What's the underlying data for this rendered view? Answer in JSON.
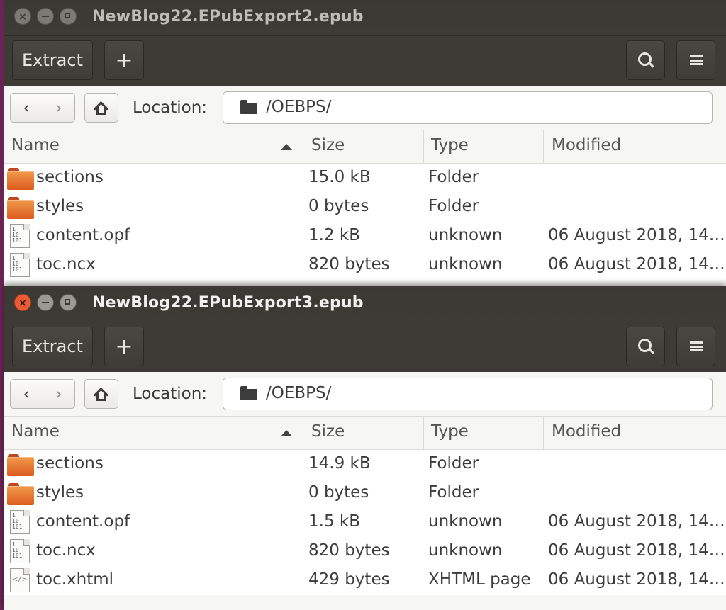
{
  "colors": {
    "close_active": "#ea5b33",
    "folder_orange": "#e0662a",
    "header_dark": "#3e3a36"
  },
  "windows": [
    {
      "title": "NewBlog22.EPubExport2.epub",
      "active": false,
      "toolbar": {
        "extract_label": "Extract",
        "add_label": "+",
        "search_icon": "search-icon",
        "menu_icon": "menu-icon"
      },
      "location": {
        "label": "Location:",
        "path": "/OEBPS/"
      },
      "columns": {
        "name": "Name",
        "size": "Size",
        "type": "Type",
        "modified": "Modified"
      },
      "files": [
        {
          "icon": "folder-icon",
          "name": "sections",
          "size": "15.0 kB",
          "type": "Folder",
          "modified": ""
        },
        {
          "icon": "folder-icon",
          "name": "styles",
          "size": "0 bytes",
          "type": "Folder",
          "modified": ""
        },
        {
          "icon": "binary-file-icon",
          "name": "content.opf",
          "size": "1.2 kB",
          "type": "unknown",
          "modified": "06 August 2018, 14…"
        },
        {
          "icon": "binary-file-icon",
          "name": "toc.ncx",
          "size": "820 bytes",
          "type": "unknown",
          "modified": "06 August 2018, 14…"
        }
      ]
    },
    {
      "title": "NewBlog22.EPubExport3.epub",
      "active": true,
      "toolbar": {
        "extract_label": "Extract",
        "add_label": "+",
        "search_icon": "search-icon",
        "menu_icon": "menu-icon"
      },
      "location": {
        "label": "Location:",
        "path": "/OEBPS/"
      },
      "columns": {
        "name": "Name",
        "size": "Size",
        "type": "Type",
        "modified": "Modified"
      },
      "files": [
        {
          "icon": "folder-icon",
          "name": "sections",
          "size": "14.9 kB",
          "type": "Folder",
          "modified": ""
        },
        {
          "icon": "folder-icon",
          "name": "styles",
          "size": "0 bytes",
          "type": "Folder",
          "modified": ""
        },
        {
          "icon": "binary-file-icon",
          "name": "content.opf",
          "size": "1.5 kB",
          "type": "unknown",
          "modified": "06 August 2018, 14…"
        },
        {
          "icon": "binary-file-icon",
          "name": "toc.ncx",
          "size": "820 bytes",
          "type": "unknown",
          "modified": "06 August 2018, 14…"
        },
        {
          "icon": "code-file-icon",
          "name": "toc.xhtml",
          "size": "429 bytes",
          "type": "XHTML page",
          "modified": "06 August 2018, 14…"
        }
      ]
    }
  ]
}
